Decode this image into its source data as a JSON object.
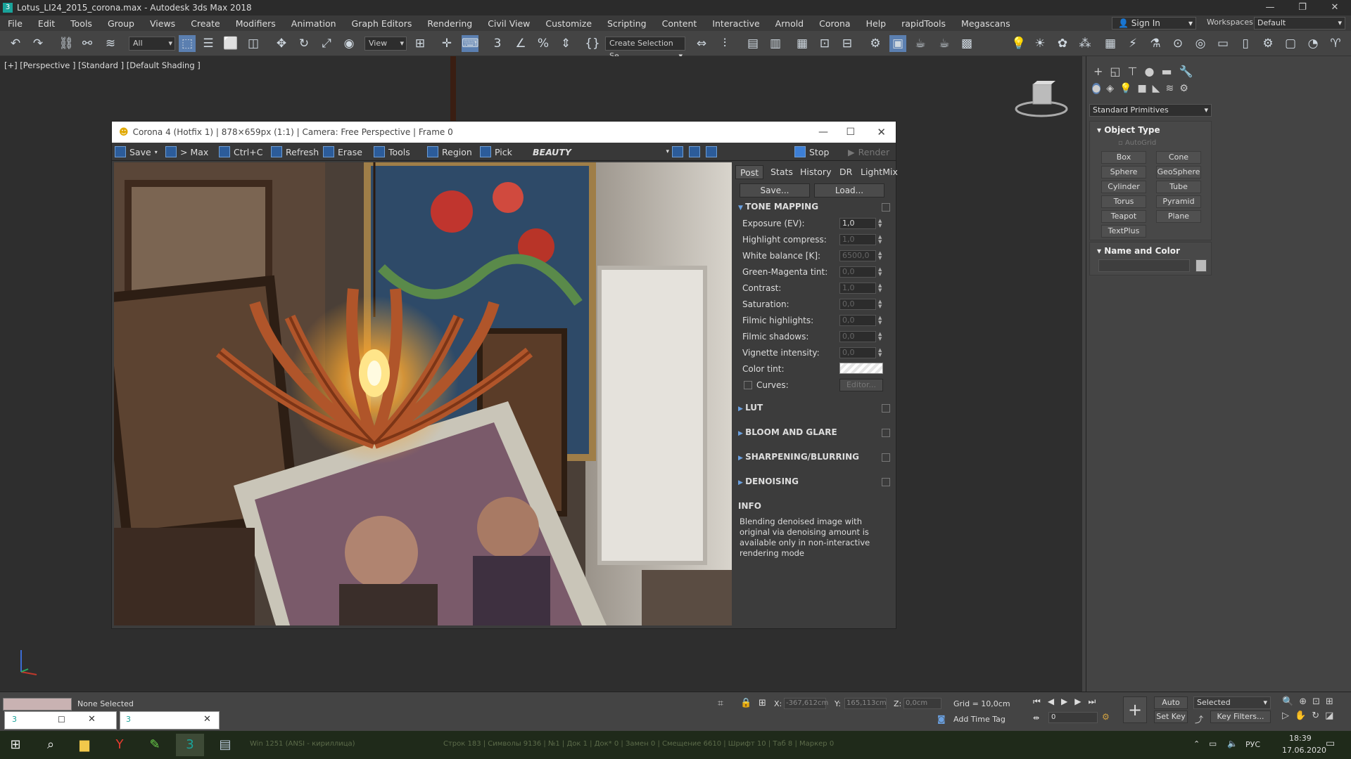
{
  "window": {
    "title": "Lotus_LI24_2015_corona.max - Autodesk 3ds Max 2018",
    "icon": "3"
  },
  "menu": [
    "File",
    "Edit",
    "Tools",
    "Group",
    "Views",
    "Create",
    "Modifiers",
    "Animation",
    "Graph Editors",
    "Rendering",
    "Civil View",
    "Customize",
    "Scripting",
    "Content",
    "Interactive",
    "Arnold",
    "Corona",
    "Help",
    "rapidTools",
    "Megascans"
  ],
  "signin": "Sign In",
  "workspaces": {
    "label": "Workspaces:",
    "value": "Default"
  },
  "toolbar": {
    "filter": "All",
    "view": "View",
    "selection_set": "Create Selection Se"
  },
  "viewport": {
    "label": "[+] [Perspective ] [Standard ] [Default Shading ]"
  },
  "cmdpanel": {
    "category": "Standard Primitives",
    "object_type": "Object Type",
    "autogrid": "AutoGrid",
    "primitives": [
      "Box",
      "Cone",
      "Sphere",
      "GeoSphere",
      "Cylinder",
      "Tube",
      "Torus",
      "Pyramid",
      "Teapot",
      "Plane",
      "TextPlus"
    ],
    "name_color": "Name and Color"
  },
  "vfb": {
    "title": "Corona 4 (Hotfix 1) | 878×659px (1:1) | Camera: Free Perspective | Frame 0",
    "buttons": {
      "save": "Save",
      "max": "> Max",
      "copy": "Ctrl+C",
      "refresh": "Refresh",
      "erase": "Erase",
      "tools": "Tools",
      "region": "Region",
      "pick": "Pick",
      "pass": "BEAUTY",
      "stop": "Stop",
      "render": "Render"
    },
    "tabs": [
      "Post",
      "Stats",
      "History",
      "DR",
      "LightMix"
    ],
    "post": {
      "save": "Save...",
      "load": "Load...",
      "tone_mapping": "TONE MAPPING",
      "params": [
        {
          "label": "Exposure (EV):",
          "value": "1,0",
          "enabled": true
        },
        {
          "label": "Highlight compress:",
          "value": "1,0",
          "enabled": false
        },
        {
          "label": "White balance [K]:",
          "value": "6500,0",
          "enabled": false
        },
        {
          "label": "Green-Magenta tint:",
          "value": "0,0",
          "enabled": false
        },
        {
          "label": "Contrast:",
          "value": "1,0",
          "enabled": false
        },
        {
          "label": "Saturation:",
          "value": "0,0",
          "enabled": false
        },
        {
          "label": "Filmic highlights:",
          "value": "0,0",
          "enabled": false
        },
        {
          "label": "Filmic shadows:",
          "value": "0,0",
          "enabled": false
        },
        {
          "label": "Vignette intensity:",
          "value": "0,0",
          "enabled": false
        }
      ],
      "color_tint": "Color tint:",
      "curves": "Curves:",
      "curves_btn": "Editor...",
      "sections": [
        "LUT",
        "BLOOM AND GLARE",
        "SHARPENING/BLURRING",
        "DENOISING"
      ],
      "info_title": "INFO",
      "info_text": "Blending denoised image with original via denoising amount is available only in non-interactive rendering mode"
    }
  },
  "status": {
    "selection": "None Selected",
    "x_label": "X:",
    "x": "-367,612cm",
    "y_label": "Y:",
    "y": "165,113cm",
    "z_label": "Z:",
    "z": "0,0cm",
    "grid": "Grid = 10,0cm",
    "add_time_tag": "Add Time Tag",
    "auto_key": "Auto Key",
    "set_key": "Set Key",
    "selected": "Selected",
    "key_filters": "Key Filters...",
    "frame": "0"
  },
  "editor_status": "Строк 183 | Символы 9136 | №1 | Док 1 | Док* 0 | Замен 0 | Смещение 6610 | Шрифт 10 | Таб 8 | Маркер 0",
  "encoding": "Win 1251 (ANSI - кириллица)",
  "taskbar": {
    "lang": "РУС",
    "time": "18:39",
    "date": "17.06.2020"
  }
}
